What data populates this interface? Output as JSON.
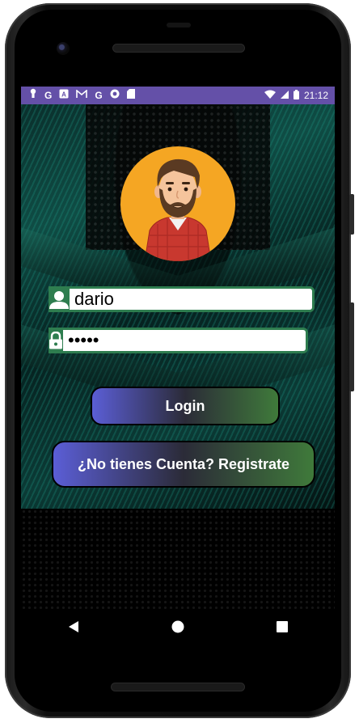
{
  "status_bar": {
    "left_icons": [
      "keyhole-icon",
      "google-icon",
      "translate-icon",
      "gmail-icon",
      "google-icon",
      "chrome-icon",
      "sd-card-icon"
    ],
    "time": "21:12"
  },
  "login_form": {
    "username_value": "dario",
    "password_value": "dario",
    "login_label": "Login",
    "register_label": "¿No tienes Cuenta? Registrate"
  },
  "colors": {
    "status_bar": "#6450a8",
    "field_accent": "#2e7d4f",
    "avatar_bg": "#f5a623",
    "button_gradient_start": "#5b5ed6",
    "button_gradient_end": "#3f7a3a"
  }
}
